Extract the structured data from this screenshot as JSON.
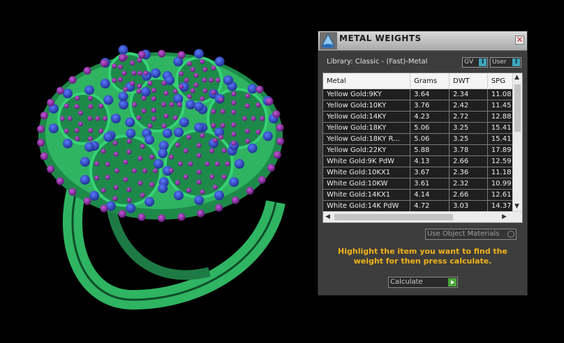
{
  "window": {
    "title": "METAL WEIGHTS",
    "close_glyph": "✕"
  },
  "library_label": "Library: Classic - (Fast)-Metal",
  "toggles": [
    {
      "label": "GV",
      "icon": "I"
    },
    {
      "label": "User",
      "icon": "I"
    }
  ],
  "table": {
    "headers": [
      "Metal",
      "Grams",
      "DWT",
      "SPG"
    ],
    "rows": [
      [
        "Yellow Gold:9KY",
        "3.64",
        "2.34",
        "11.08"
      ],
      [
        "Yellow Gold:10KY",
        "3.76",
        "2.42",
        "11.45"
      ],
      [
        "Yellow Gold:14KY",
        "4.23",
        "2.72",
        "12.88"
      ],
      [
        "Yellow Gold:18KY",
        "5.06",
        "3.25",
        "15.41"
      ],
      [
        "Yellow Gold:18KY R...",
        "5.06",
        "3.25",
        "15.41"
      ],
      [
        "Yellow Gold:22KY",
        "5.88",
        "3.78",
        "17.89"
      ],
      [
        "White Gold:9K PdW",
        "4.13",
        "2.66",
        "12.59"
      ],
      [
        "White Gold:10KX1",
        "3.67",
        "2.36",
        "11.18"
      ],
      [
        "White Gold:10KW",
        "3.61",
        "2.32",
        "10.99"
      ],
      [
        "White Gold:14KX1",
        "4.14",
        "2.66",
        "12.61"
      ],
      [
        "White Gold:14K PdW",
        "4.72",
        "3.03",
        "14.37"
      ]
    ]
  },
  "use_object_materials": "Use Object Materials",
  "hint": "Highlight the item you want to find the weight for then press calculate.",
  "calculate_label": "Calculate",
  "colors": {
    "accent": "#f0b21a",
    "panel": "#3d3d3d",
    "ring_metal": "#2fb462",
    "gem_blue": "#2f4bd0",
    "gem_purple": "#8e2aa8"
  }
}
